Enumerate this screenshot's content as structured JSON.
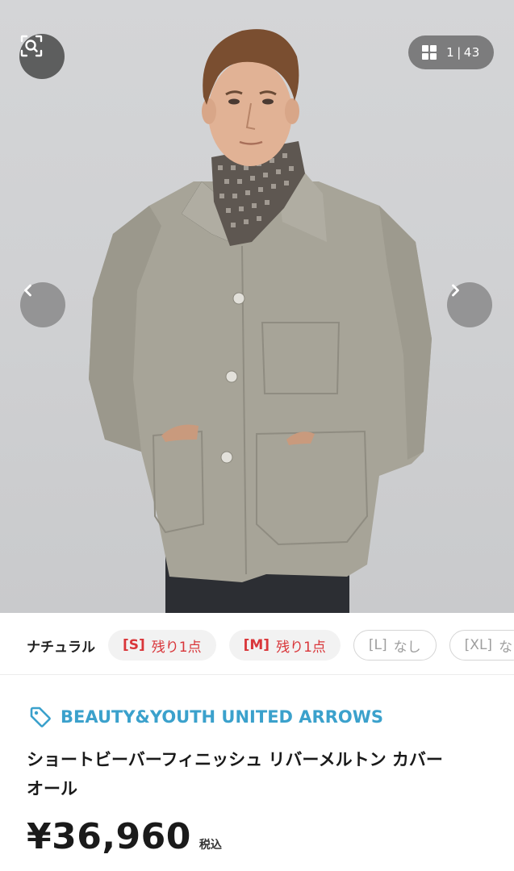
{
  "gallery": {
    "counter_current": "1",
    "counter_separator": "|",
    "counter_total": "43"
  },
  "sizes": {
    "color_name": "ナチュラル",
    "chips": [
      {
        "size": "[S]",
        "stock": "残り1点",
        "available": true
      },
      {
        "size": "[M]",
        "stock": "残り1点",
        "available": true
      },
      {
        "size": "[L]",
        "stock": "なし",
        "available": false
      },
      {
        "size": "[XL]",
        "stock": "な",
        "available": false
      }
    ]
  },
  "product": {
    "brand": "BEAUTY&YOUTH UNITED ARROWS",
    "title_line1": "ショートビーバーフィニッシュ リバーメルトン カバー",
    "title_line2": "オール",
    "price": "¥36,960",
    "tax_label": "税込"
  },
  "colors": {
    "brand_blue": "#3ba1cc",
    "stock_red": "#d9363a"
  },
  "icons": {
    "lens": "image-search-icon",
    "grid": "grid-icon",
    "prev": "chevron-left-icon",
    "next": "chevron-right-icon",
    "tag": "tag-icon"
  }
}
